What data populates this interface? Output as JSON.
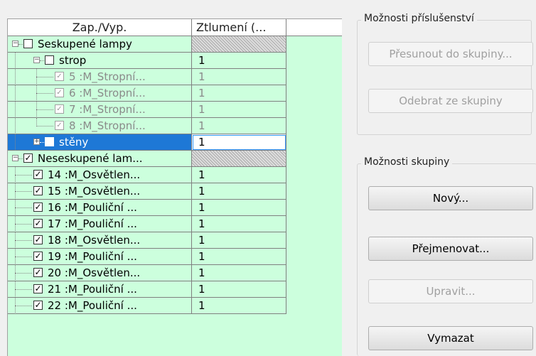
{
  "grid": {
    "headers": {
      "col1": "Zap./Vyp.",
      "col2": "Ztlumení (..."
    },
    "rows": [
      {
        "label": "Seskupené lampy",
        "value": "",
        "checked": false,
        "expander": "−"
      },
      {
        "label": "strop",
        "value": "1",
        "checked": false,
        "expander": "−"
      },
      {
        "label": "5 :M_Stropní...",
        "value": "1",
        "checked": true
      },
      {
        "label": "6 :M_Stropní...",
        "value": "1",
        "checked": true
      },
      {
        "label": "7 :M_Stropní...",
        "value": "1",
        "checked": true
      },
      {
        "label": "8 :M_Stropní...",
        "value": "1",
        "checked": true
      },
      {
        "label": "stěny",
        "value": "1",
        "checked": false,
        "expander": "+"
      },
      {
        "label": "Neseskupené lam...",
        "value": "",
        "checked": true,
        "expander": "−"
      },
      {
        "label": "14 :M_Osvětlen...",
        "value": "1",
        "checked": true
      },
      {
        "label": "15 :M_Osvětlen...",
        "value": "1",
        "checked": true
      },
      {
        "label": "16 :M_Pouliční ...",
        "value": "1",
        "checked": true
      },
      {
        "label": "17 :M_Pouliční ...",
        "value": "1",
        "checked": true
      },
      {
        "label": "18 :M_Osvětlen...",
        "value": "1",
        "checked": true
      },
      {
        "label": "19 :M_Pouliční ...",
        "value": "1",
        "checked": true
      },
      {
        "label": "20 :M_Osvětlen...",
        "value": "1",
        "checked": true
      },
      {
        "label": "21 :M_Pouliční ...",
        "value": "1",
        "checked": true
      },
      {
        "label": "22 :M_Pouliční ...",
        "value": "1",
        "checked": true
      }
    ]
  },
  "accessory_options": {
    "title": "Možnosti příslušenství",
    "move_to_group": "Přesunout do skupiny...",
    "remove_from_group": "Odebrat ze skupiny"
  },
  "group_options": {
    "title": "Možnosti skupiny",
    "new": "Nový...",
    "rename": "Přejmenovat...",
    "edit": "Upravit...",
    "delete": "Vymazat"
  },
  "colors": {
    "grid_bg": "#ccffdd",
    "selection": "#1e78d6"
  },
  "icons": {
    "expand": "plus-box-icon",
    "collapse": "minus-box-icon",
    "check": "checkbox-icon"
  }
}
